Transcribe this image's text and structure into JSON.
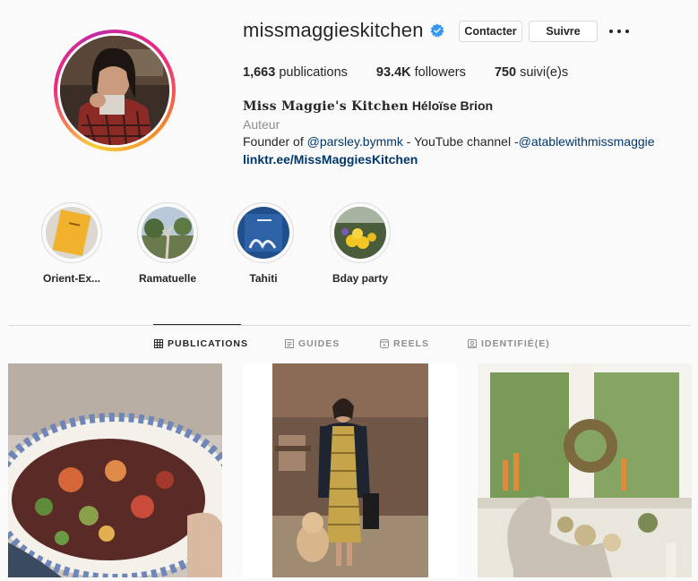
{
  "profile": {
    "username": "missmaggieskitchen",
    "verified": true,
    "contact_label": "Contacter",
    "follow_label": "Suivre",
    "more_icon": "ellipsis-icon"
  },
  "stats": {
    "posts_value": "1,663",
    "posts_label": "publications",
    "followers_value": "93.4K",
    "followers_label": "followers",
    "following_value": "750",
    "following_label": "suivi(e)s"
  },
  "bio": {
    "name_fancy": "Miss Maggie's Kitchen",
    "name_plain": "Héloïse Brion",
    "category": "Auteur",
    "line_prefix": "Founder of ",
    "mention1": "@parsley.bymmk",
    "line_middle": " - YouTube channel -",
    "mention2": "@atablewithmissmaggie",
    "link": "linktr.ee/MissMaggiesKitchen"
  },
  "highlights": [
    {
      "label": "Orient-Ex..."
    },
    {
      "label": "Ramatuelle"
    },
    {
      "label": "Tahiti"
    },
    {
      "label": "Bday party"
    }
  ],
  "tabs": [
    {
      "label": "PUBLICATIONS",
      "icon": "grid-icon",
      "active": true
    },
    {
      "label": "GUIDES",
      "icon": "guides-icon",
      "active": false
    },
    {
      "label": "REELS",
      "icon": "reels-icon",
      "active": false
    },
    {
      "label": "IDENTIFIÉ(E)",
      "icon": "tagged-icon",
      "active": false
    }
  ],
  "colors": {
    "text": "#262626",
    "secondary": "#8e8e8e",
    "link": "#00376b",
    "verified": "#3897f0",
    "border": "#dbdbdb"
  }
}
